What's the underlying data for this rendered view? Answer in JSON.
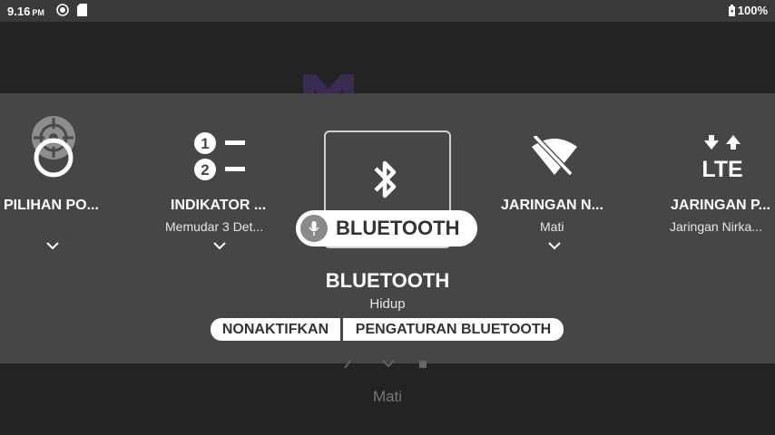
{
  "status_bar": {
    "time": "9.16",
    "ampm": "PM",
    "battery_text": "100%",
    "icons": [
      "settings-sync-icon",
      "sd-card-icon",
      "battery-icon"
    ]
  },
  "quick_settings": {
    "tiles": [
      {
        "title": "PILIHAN PO...",
        "subtitle": "",
        "icon": "location-target-icon"
      },
      {
        "title": "INDIKATOR ...",
        "subtitle": "Memudar 3 Det...",
        "icon": "numbered-list-icon"
      },
      {
        "title": "JARINGAN N...",
        "subtitle": "Mati",
        "icon": "wifi-off-icon"
      },
      {
        "title": "JARINGAN P...",
        "subtitle": "Jaringan Nirka...",
        "icon": "lte-data-icon"
      }
    ],
    "focused": {
      "voice_chip_label": "BLUETOOTH",
      "title": "BLUETOOTH",
      "subtitle": "Hidup",
      "icon": "bluetooth-icon",
      "buttons": {
        "turn_off": "NONAKTIFKAN",
        "settings": "PENGATURAN BLUETOOTH"
      }
    }
  },
  "background": {
    "partial_text": "Mati"
  }
}
